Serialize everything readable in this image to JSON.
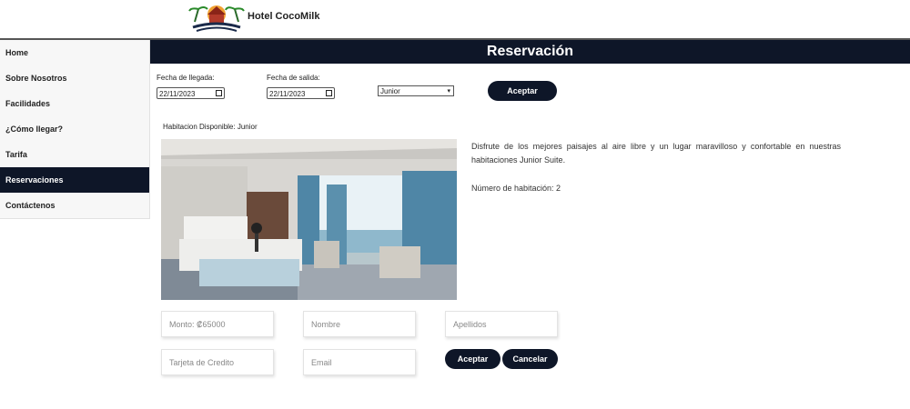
{
  "brand": {
    "name": "Hotel CocoMilk"
  },
  "nav": {
    "items": [
      {
        "label": "Home"
      },
      {
        "label": "Sobre Nosotros"
      },
      {
        "label": "Facilidades"
      },
      {
        "label": "¿Cómo llegar?"
      },
      {
        "label": "Tarifa"
      },
      {
        "label": "Reservaciones",
        "active": true
      },
      {
        "label": "Contáctenos"
      }
    ]
  },
  "page": {
    "title": "Reservación"
  },
  "search": {
    "arrival_label": "Fecha de llegada:",
    "arrival_value": "22/11/2023",
    "departure_label": "Fecha de salida:",
    "departure_value": "22/11/2023",
    "room_type_value": "Junior",
    "accept_label": "Aceptar"
  },
  "result": {
    "availability": "Habitacion Disponible: Junior",
    "description": "Disfrute de los mejores paisajes al aire libre y un lugar maravilloso y confortable en nuestras habitaciones Junior Suite.",
    "room_number": "Número de habitación: 2"
  },
  "form": {
    "amount_placeholder": "Monto: ₡65000",
    "name_placeholder": "Nombre",
    "lastname_placeholder": "Apellidos",
    "card_placeholder": "Tarjeta de Credito",
    "email_placeholder": "Email",
    "accept_label": "Aceptar",
    "cancel_label": "Cancelar"
  },
  "icons": {
    "logo": "hotel-logo-icon",
    "calendar": "calendar-icon",
    "dropdown": "chevron-down-icon"
  },
  "colors": {
    "navy": "#0e1628"
  }
}
